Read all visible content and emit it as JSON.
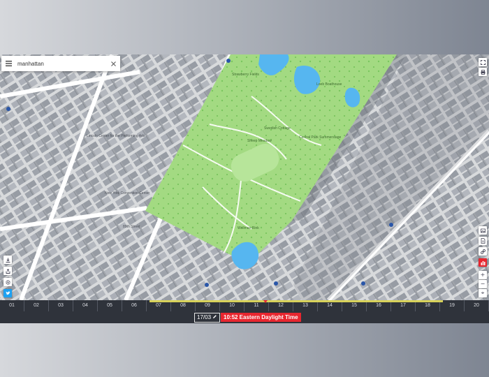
{
  "search": {
    "value": "manhattan",
    "menu_icon": "hamburger-menu-icon",
    "clear_icon": "close-icon"
  },
  "map_labels": [
    "Strawberry Fields",
    "Loeb Boathouse",
    "Swedish Cottage",
    "Central Park Summerstage",
    "Sheep Meadow",
    "Wollman Rink",
    "Lincoln Center for the Performing Arts",
    "New York Convention Center",
    "89th Street"
  ],
  "right_controls": {
    "top": [
      "fullscreen-icon",
      "print-icon"
    ],
    "middle": [
      "gallery-icon",
      "document-icon",
      "share-link-icon",
      "bar-chart-icon"
    ],
    "zoom_in": "+",
    "zoom_out": "−",
    "reset": "⌖"
  },
  "left_controls": [
    "download-icon",
    "share-icon",
    "settings-icon",
    "twitter-icon"
  ],
  "timeline": {
    "hours": [
      "01",
      "02",
      "03",
      "04",
      "05",
      "06",
      "07",
      "08",
      "09",
      "10",
      "11",
      "12",
      "13",
      "14",
      "15",
      "16",
      "17",
      "18",
      "19",
      "20"
    ],
    "daylight_start_hour": 6.1,
    "daylight_end_hour": 18.1,
    "current_hour": 10.87
  },
  "date": "17/03",
  "time": "10:52 Eastern Daylight Time",
  "colors": {
    "accent": "#e8262f",
    "park": "#9ed77c",
    "water": "#56b6f0",
    "daylight": "#d8d25a"
  }
}
